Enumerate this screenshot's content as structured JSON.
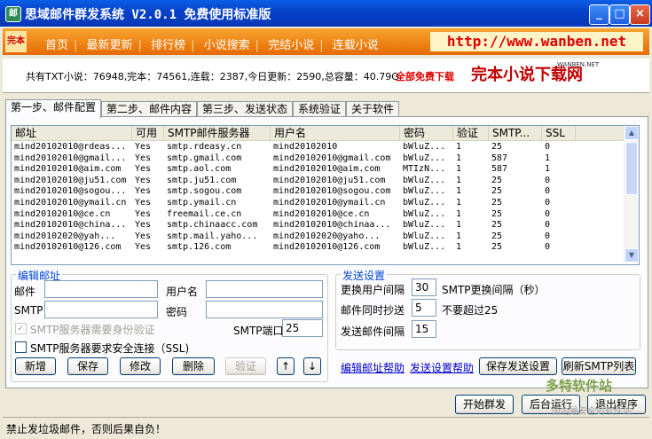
{
  "window": {
    "title": "思域邮件群发系统 V2.0.1 免费使用标准版",
    "buttons": [
      "_",
      "□",
      "×"
    ]
  },
  "banner": {
    "nav": [
      "首页",
      "最新更新",
      "排行榜",
      "小说搜索",
      "完结小说",
      "连载小说"
    ],
    "url": "http://www.wanben.net"
  },
  "stats": {
    "text": "共有TXT小说：76948,完本：74561,连载：2387,今日更新：2590,总容量：40.79G",
    "download": "全部免费下载",
    "brand": "完本小说下载网",
    "brand_en": "WANBEN.NET"
  },
  "tabs": [
    "第一步、邮件配置",
    "第二步、邮件内容",
    "第三步、发送状态",
    "系统验证",
    "关于软件"
  ],
  "table": {
    "columns": [
      "邮址",
      "可用",
      "SMTP邮件服务器",
      "用户名",
      "密码",
      "验证",
      "SMTP...",
      "SSL"
    ],
    "rows": [
      [
        "mind20102010@rdeas...",
        "Yes",
        "smtp.rdeasy.cn",
        "mind20102010",
        "bWluZ...",
        "1",
        "25",
        "0"
      ],
      [
        "mind20102010@gmail...",
        "Yes",
        "smtp.gmail.com",
        "mind20102010@gmail.com",
        "bWluZ...",
        "1",
        "587",
        "1"
      ],
      [
        "mind20102010@aim.com",
        "Yes",
        "smtp.aol.com",
        "mind20102010@aim.com",
        "MTIzN...",
        "1",
        "587",
        "1"
      ],
      [
        "mind20102010@ju51.com",
        "Yes",
        "smtp.ju51.com",
        "mind20102010@ju51.com",
        "bWluZ...",
        "1",
        "25",
        "0"
      ],
      [
        "mind20102010@sogou...",
        "Yes",
        "smtp.sogou.com",
        "mind20102010@sogou.com",
        "bWluZ...",
        "1",
        "25",
        "0"
      ],
      [
        "mind20102010@ymail.cn",
        "Yes",
        "smtp.ymail.cn",
        "mind20102010@ymail.cn",
        "bWluZ...",
        "1",
        "25",
        "0"
      ],
      [
        "mind20102010@ce.cn",
        "Yes",
        "freemail.ce.cn",
        "mind20102010@ce.cn",
        "bWluZ...",
        "1",
        "25",
        "0"
      ],
      [
        "mind20102010@china...",
        "Yes",
        "smtp.chinaacc.com",
        "mind20102010@chinaa...",
        "bWluZ...",
        "1",
        "25",
        "0"
      ],
      [
        "mind20102020@yah...",
        "Yes",
        "smtp.mail.yaho...",
        "mind20102020@yaho...",
        "bWluZ...",
        "1",
        "25",
        "0"
      ],
      [
        "mind20102010@126.com",
        "Yes",
        "smtp.126.com",
        "mind20102010@126.com",
        "bWluZ...",
        "1",
        "25",
        "0"
      ]
    ]
  },
  "edit": {
    "legend": "编辑邮址",
    "email_label": "邮件",
    "username_label": "用户名",
    "smtp_label": "SMTP",
    "password_label": "密码",
    "auth_check": "SMTP服务器需要身份验证",
    "ssl_check": "SMTP服务器要求安全连接（SSL)",
    "port_label": "SMTP端口",
    "port_value": "25",
    "buttons": [
      "新增",
      "保存",
      "修改",
      "删除",
      "验证",
      "↑",
      "↓"
    ]
  },
  "send": {
    "legend": "发送设置",
    "switch_user_label": "更换用户间隔",
    "switch_user_value": "30",
    "switch_user_unit": "SMTP更换间隔（秒）",
    "cc_label": "邮件同时抄送",
    "cc_value": "5",
    "cc_note": "不要超过25",
    "interval_label": "发送邮件间隔",
    "interval_value": "15"
  },
  "links": {
    "edit_help": "编辑邮址帮助",
    "send_help": "发送设置帮助"
  },
  "actions": {
    "save_settings": "保存发送设置",
    "refresh_smtp": "刷新SMTP列表",
    "start": "开始群发",
    "background": "后台运行",
    "exit": "退出程序"
  },
  "status": {
    "text": "禁止发垃圾邮件，否则后果自负！"
  },
  "watermark": {
    "line1": "多特软件站",
    "line2": "国内最安全的软件站"
  }
}
